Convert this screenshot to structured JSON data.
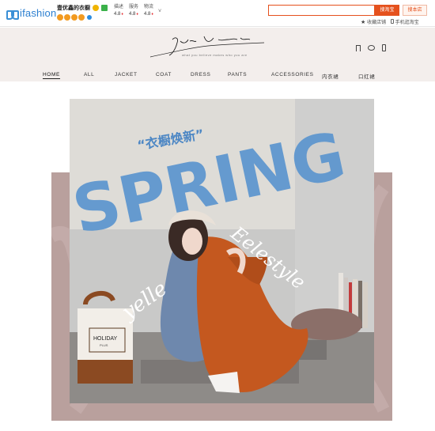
{
  "topbar": {
    "logo_text": "ifashion",
    "shop_name": "壹优鑫的衣橱",
    "ratings": [
      {
        "label": "描述",
        "value": "4.8"
      },
      {
        "label": "服务",
        "value": "4.8"
      },
      {
        "label": "物流",
        "value": "4.8"
      }
    ],
    "more_label": "˅",
    "search_placeholder": "",
    "search_button": "搜淘宝",
    "shop_search_button": "搜本店",
    "favorite_label": "收藏店铺",
    "mobile_label": "手机逛淘宝"
  },
  "header": {
    "signature": "Joyce Vendae",
    "tagline": "what you believe makes who you are"
  },
  "nav": {
    "items": [
      {
        "label": "HOME"
      },
      {
        "label": "ALL"
      },
      {
        "label": "JACKET"
      },
      {
        "label": "COAT"
      },
      {
        "label": "DRESS"
      },
      {
        "label": "PANTS"
      },
      {
        "label": "ACCESSORIES"
      },
      {
        "label": "内衣裙"
      },
      {
        "label": "口红裙"
      }
    ]
  },
  "hero": {
    "headline_cn": "“衣橱焕新”",
    "headline_en": "SPRING",
    "script_left": "yelle",
    "script_right": "Eelestyle",
    "bag_text_1": "HOLIDAY",
    "bag_text_2": "PLUS"
  },
  "colors": {
    "accent": "#e5511d",
    "brand_blue": "#2c7fd0",
    "header_bg": "#f3eeec",
    "hero_panel": "#b9a09d",
    "spring_blue": "#5b95cf",
    "dress": "#c4581f"
  }
}
